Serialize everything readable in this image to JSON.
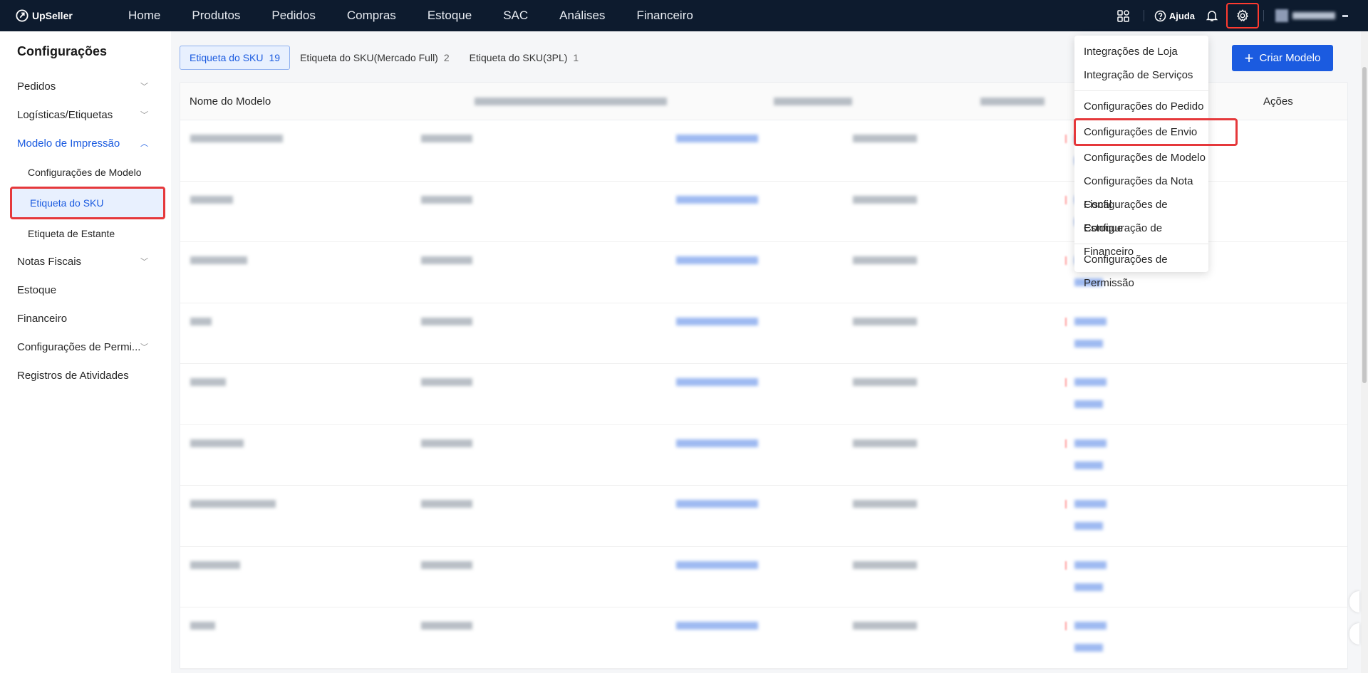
{
  "brand": {
    "name": "UpSeller"
  },
  "nav": [
    "Home",
    "Produtos",
    "Pedidos",
    "Compras",
    "Estoque",
    "SAC",
    "Análises",
    "Financeiro"
  ],
  "topright": {
    "help": "Ajuda"
  },
  "sidebar": {
    "title": "Configurações",
    "items": [
      {
        "label": "Pedidos",
        "chevron": "down"
      },
      {
        "label": "Logísticas/Etiquetas",
        "chevron": "down"
      },
      {
        "label": "Modelo de Impressão",
        "chevron": "up",
        "active": true
      },
      {
        "sub": "Configurações de Modelo"
      },
      {
        "sub": "Etiqueta do SKU",
        "selected": true
      },
      {
        "sub": "Etiqueta de Estante"
      },
      {
        "label": "Notas Fiscais",
        "chevron": "down"
      },
      {
        "label": "Estoque"
      },
      {
        "label": "Financeiro"
      },
      {
        "label": "Configurações de Permi...",
        "chevron": "down"
      },
      {
        "label": "Registros de Atividades"
      }
    ]
  },
  "tabs": [
    {
      "label": "Etiqueta do SKU",
      "count": "19",
      "active": true
    },
    {
      "label": "Etiqueta do SKU(Mercado Full)",
      "count": "2"
    },
    {
      "label": "Etiqueta do SKU(3PL)",
      "count": "1"
    }
  ],
  "create_button": "Criar Modelo",
  "table": {
    "headers": {
      "name": "Nome do Modelo",
      "actions": "Ações"
    }
  },
  "settings_menu": {
    "group1": [
      "Integrações de Loja",
      "Integração de Serviços"
    ],
    "group2": [
      "Configurações do Pedido",
      "Configurações de Envio",
      "Configurações de Modelo",
      "Configurações da Nota Fiscal",
      "Configurações de Estoque",
      "Configuração de Financeiro"
    ],
    "group3": [
      "Configurações de Permissão"
    ],
    "highlighted": "Configurações de Envio"
  },
  "colors": {
    "topbar": "#0d1b2e",
    "accent": "#1b5be0",
    "highlight": "#e5383b"
  }
}
